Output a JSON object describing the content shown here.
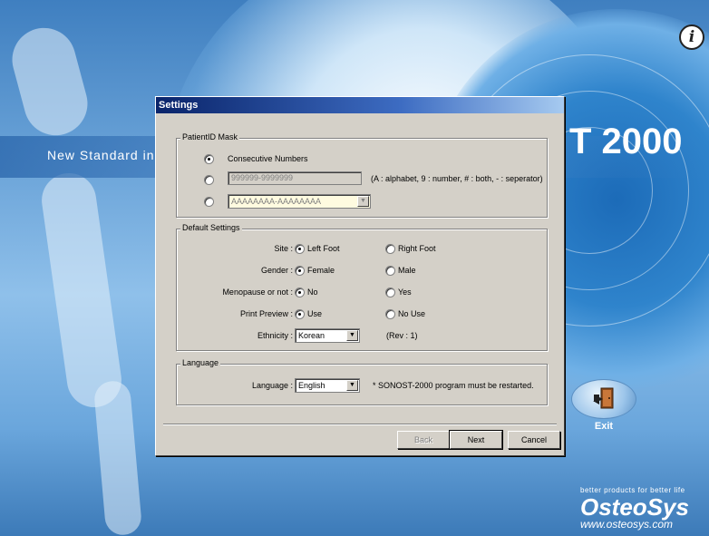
{
  "background": {
    "tagline": "New Standard in",
    "product_title": "T 2000",
    "info_label": "i",
    "exit_label": "Exit",
    "brand_tagline": "better products for better life",
    "brand_name": "OsteoSys",
    "brand_url": "www.osteosys.com"
  },
  "dialog": {
    "title": "Settings",
    "patient_id_mask": {
      "legend": "PatientID Mask",
      "option1_label": "Consecutive Numbers",
      "option1_selected": true,
      "option2_value": "999999-9999999",
      "option2_selected": false,
      "mask_help": "(A : alphabet, 9 : number, # : both, - : seperator)",
      "option3_value": "AAAAAAAA-AAAAAAAA",
      "option3_selected": false
    },
    "default_settings": {
      "legend": "Default Settings",
      "site_label": "Site :",
      "site_left": "Left Foot",
      "site_right": "Right Foot",
      "gender_label": "Gender :",
      "gender_female": "Female",
      "gender_male": "Male",
      "menopause_label": "Menopause or not :",
      "menopause_no": "No",
      "menopause_yes": "Yes",
      "print_preview_label": "Print Preview :",
      "print_use": "Use",
      "print_no_use": "No Use",
      "ethnicity_label": "Ethnicity :",
      "ethnicity_value": "Korean",
      "rev_text": "(Rev : 1)"
    },
    "language": {
      "legend": "Language",
      "language_label": "Language :",
      "language_value": "English",
      "restart_note": "* SONOST-2000 program must be restarted."
    },
    "buttons": {
      "back": "Back",
      "next": "Next",
      "cancel": "Cancel"
    }
  }
}
